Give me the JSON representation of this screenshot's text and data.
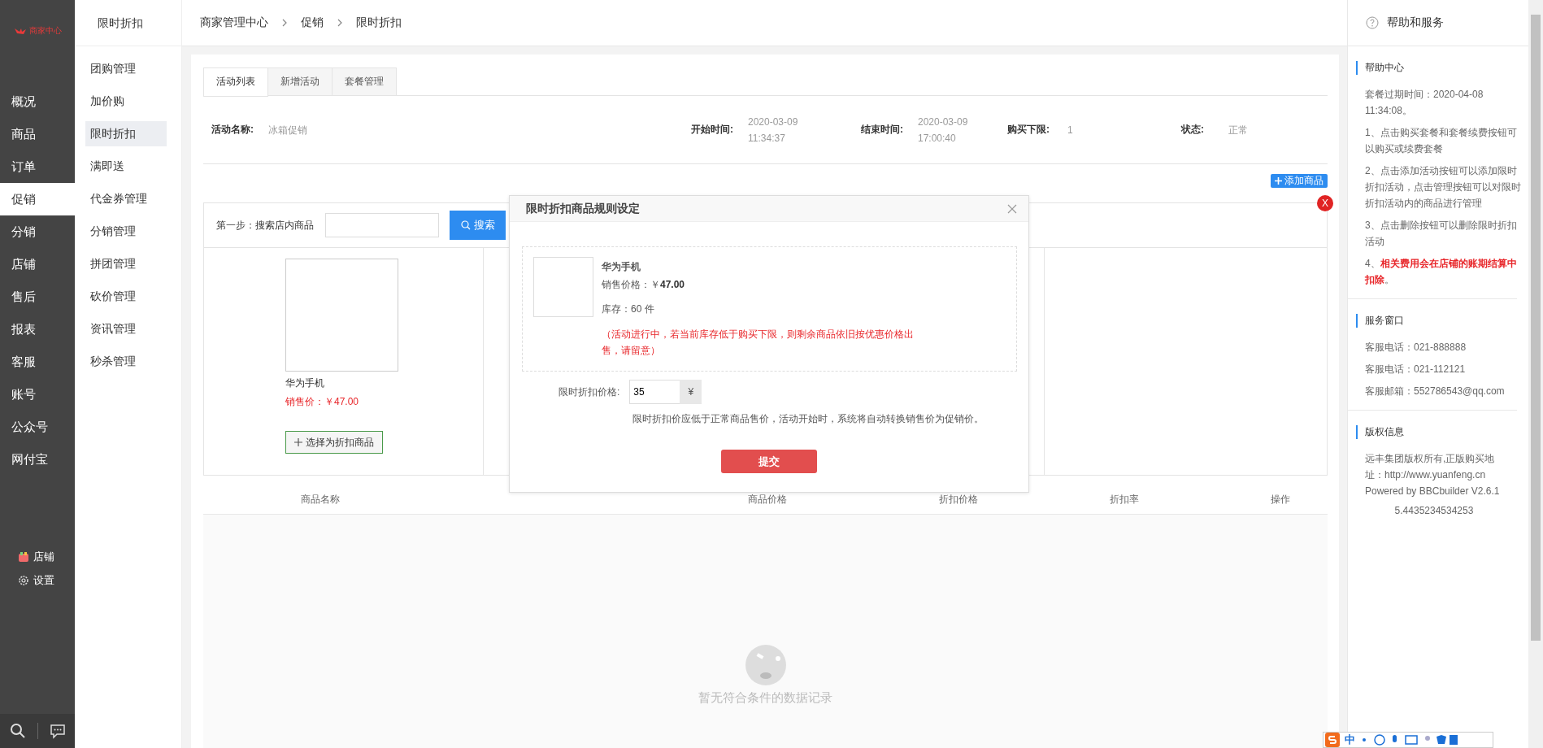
{
  "logo": {
    "text": "商家中心"
  },
  "nav": [
    {
      "label": "概况",
      "selected": false
    },
    {
      "label": "商品",
      "selected": false
    },
    {
      "label": "订单",
      "selected": false
    },
    {
      "label": "促销",
      "selected": true
    },
    {
      "label": "分销",
      "selected": false
    },
    {
      "label": "店铺",
      "selected": false
    },
    {
      "label": "售后",
      "selected": false
    },
    {
      "label": "报表",
      "selected": false
    },
    {
      "label": "客服",
      "selected": false
    },
    {
      "label": "账号",
      "selected": false
    },
    {
      "label": "公众号",
      "selected": false
    },
    {
      "label": "网付宝",
      "selected": false
    }
  ],
  "nav_footer": [
    {
      "kind": "store",
      "label": "店铺"
    },
    {
      "kind": "settings",
      "label": "设置"
    }
  ],
  "subnav": {
    "title": "限时折扣",
    "items": [
      {
        "label": "团购管理",
        "selected": false
      },
      {
        "label": "加价购",
        "selected": false
      },
      {
        "label": "限时折扣",
        "selected": true
      },
      {
        "label": "满即送",
        "selected": false
      },
      {
        "label": "代金券管理",
        "selected": false
      },
      {
        "label": "分销管理",
        "selected": false
      },
      {
        "label": "拼团管理",
        "selected": false
      },
      {
        "label": "砍价管理",
        "selected": false
      },
      {
        "label": "资讯管理",
        "selected": false
      },
      {
        "label": "秒杀管理",
        "selected": false
      }
    ]
  },
  "breadcrumb": [
    "商家管理中心",
    "促销",
    "限时折扣"
  ],
  "tabs": [
    {
      "label": "活动列表",
      "selected": true
    },
    {
      "label": "新增活动",
      "selected": false
    },
    {
      "label": "套餐管理",
      "selected": false
    }
  ],
  "activity": [
    {
      "label": "活动名称:",
      "value": "冰箱促销"
    },
    {
      "label": "开始时间:",
      "value": "2020-03-09 11:34:37"
    },
    {
      "label": "结束时间:",
      "value": "2020-03-09 17:00:40"
    },
    {
      "label": "购买下限:",
      "value": "1"
    },
    {
      "label": "状态:",
      "value": "正常"
    }
  ],
  "add_button": "添加商品",
  "search": {
    "label": "第一步：搜索店内商品",
    "button": "搜索"
  },
  "products": [
    {
      "name": "华为手机",
      "price": "销售价：￥47.00",
      "button": "选择为折扣商品"
    }
  ],
  "close_badge": "X",
  "modal": {
    "title": "限时折扣商品规则设定",
    "product_name": "华为手机",
    "price": "销售价格：￥**47.00**",
    "stock": "库存：60 件",
    "notice": "（活动进行中，若当前库存低于购买下限，则剩余商品依旧按优惠价格出售，请留意）",
    "field_label": "限时折扣价格:",
    "value": "35",
    "unit": "¥",
    "hint": "限时折扣价应低于正常商品售价，活动开始时，系统将自动转换销售价为促销价。",
    "submit": "提交"
  },
  "table": {
    "columns": [
      "商品名称",
      "商品价格",
      "折扣价格",
      "折扣率",
      "操作"
    ],
    "empty_text": "暂无符合条件的数据记录"
  },
  "help": {
    "title": "帮助和服务",
    "sections": [
      {
        "title": "帮助中心",
        "paragraphs": [
          "套餐过期时间：2020-04-08 11:34:08。",
          "1、点击购买套餐和套餐续费按钮可以购买或续费套餐",
          "2、点击添加活动按钮可以添加限时折扣活动，点击管理按钮可以对限时折扣活动内的商品进行管理",
          "3、点击删除按钮可以删除限时折扣活动",
          "4、**相关费用会在店铺的账期结算中扣除**。"
        ]
      },
      {
        "title": "服务窗口",
        "paragraphs": [
          "客服电话：021-888888",
          "客服电话：021-112121",
          "客服邮箱：552786543@qq.com"
        ]
      },
      {
        "title": "版权信息",
        "paragraphs": [
          "远丰集团版权所有,正版购买地址：http://www.yuanfeng.cn Powered by BBCbuilder V2.6.1"
        ],
        "footnote": "5.4435234534253"
      }
    ]
  },
  "ime_bar": {
    "label": "中"
  }
}
